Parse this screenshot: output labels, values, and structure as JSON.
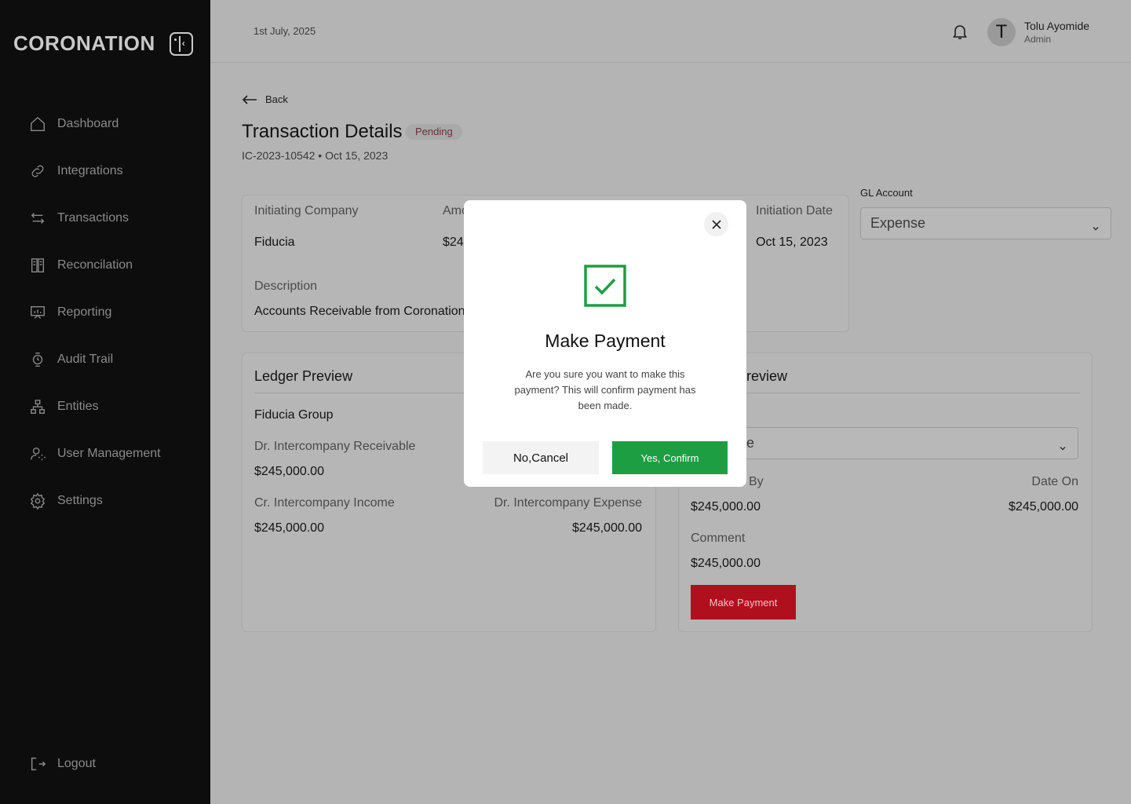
{
  "app": {
    "logo": "CORONATION"
  },
  "sidebar": {
    "items": [
      {
        "label": "Dashboard",
        "icon": "home-icon"
      },
      {
        "label": "Integrations",
        "icon": "link-icon"
      },
      {
        "label": "Transactions",
        "icon": "arrows-icon"
      },
      {
        "label": "Reconcilation",
        "icon": "book-icon"
      },
      {
        "label": "Reporting",
        "icon": "presentation-icon"
      },
      {
        "label": "Audit Trail",
        "icon": "watch-icon"
      },
      {
        "label": "Entities",
        "icon": "hierarchy-icon"
      },
      {
        "label": "User Management",
        "icon": "user-gear-icon"
      },
      {
        "label": "Settings",
        "icon": "gear-icon"
      }
    ],
    "logout": "Logout"
  },
  "header": {
    "date": "1st July, 2025",
    "avatar_initial": "T",
    "user_name": "Tolu Ayomide",
    "user_role": "Admin"
  },
  "page": {
    "back": "Back",
    "title": "Transaction Details",
    "status": "Pending",
    "subtitle": "IC-2023-10542 • Oct 15, 2023"
  },
  "details": {
    "initiating_company_label": "Initiating Company",
    "initiating_company": "Fiducia",
    "amount_label": "Amo",
    "amount": "$24",
    "initiation_date_label": "Initiation Date",
    "initiation_date": "Oct 15, 2023",
    "description_label": "Description",
    "description": "Accounts Receivable from Coronation"
  },
  "gl_account": {
    "label": "GL Account",
    "value": "Expense"
  },
  "ledger": {
    "title": "Ledger Preview",
    "group": "Fiducia Group",
    "dr_receivable_label": "Dr. Intercompany Receivable",
    "dr_receivable": "$245,000.00",
    "cr_income_label": "Cr. Intercompany Income",
    "cr_income": "$245,000.00",
    "dr_expense_label": "Dr. Intercompany Expense",
    "dr_expense": "$245,000.00"
  },
  "right_panel": {
    "title": "review",
    "select_value": "e",
    "approved_by_label": "By",
    "approved_by": "$245,000.00",
    "date_on_label": "Date On",
    "date_on": "$245,000.00",
    "comment_label": "Comment",
    "comment": "$245,000.00",
    "make_payment": "Make Payment"
  },
  "modal": {
    "title": "Make Payment",
    "message": "Are you sure you want to make this payment?  This will confirm payment has been made.",
    "cancel": "No,Cancel",
    "confirm": "Yes, Confirm"
  },
  "colors": {
    "confirm": "#1e9e43",
    "make_payment": "#b0101e",
    "sidebar": "#0d0d0d"
  }
}
